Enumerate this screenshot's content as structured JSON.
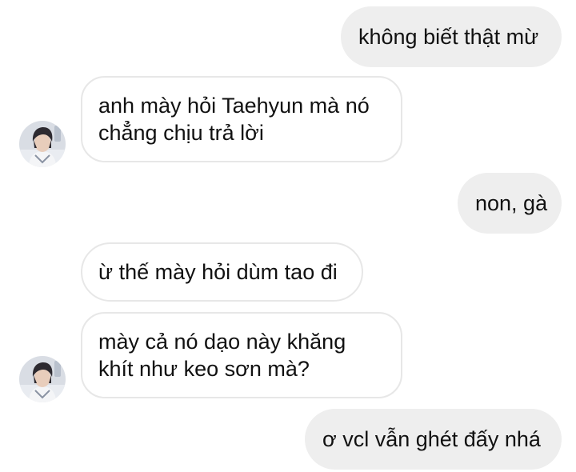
{
  "messages": [
    {
      "side": "out",
      "lines": [
        "không biết thật mừ"
      ]
    },
    {
      "side": "in",
      "lines": [
        "anh mày hỏi Taehyun mà nó",
        "chẳng chịu trả lời"
      ],
      "avatar": true
    },
    {
      "side": "out",
      "lines": [
        "non, gà"
      ]
    },
    {
      "side": "in",
      "lines": [
        "ừ thế mày hỏi dùm tao đi"
      ],
      "avatar": false
    },
    {
      "side": "in",
      "lines": [
        "mày cả nó dạo này khăng",
        "khít như keo sơn mà?"
      ],
      "avatar": true
    },
    {
      "side": "out",
      "lines": [
        "ơ vcl vẫn ghét đấy nhá"
      ]
    }
  ],
  "colors": {
    "outgoing_bubble": "#eeeeee",
    "incoming_border": "#e7e7e7",
    "text": "#111111"
  },
  "icons": {
    "avatar": "contact-avatar-photo"
  }
}
